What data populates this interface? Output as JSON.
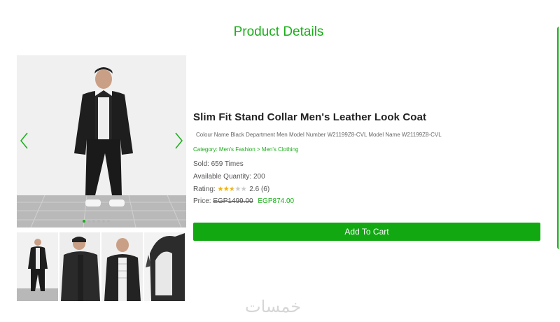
{
  "page": {
    "title": "Product Details"
  },
  "product": {
    "name": "Slim Fit Stand Collar Men's Leather Look Coat",
    "description": "Colour Name Black Department Men Model Number W21199Z8-CVL Model Name W21199Z8-CVL",
    "category_label": "Category:",
    "category_path": "Men's Fashion > Men's Clothing",
    "sold": "Sold: 659 Times",
    "quantity": "Available Quantity: 200",
    "rating_label": "Rating:",
    "rating_value": "2.6",
    "rating_count": "(6)",
    "rating_stars": 2.6,
    "price_label": "Price:",
    "old_price": "EGP1499.00",
    "new_price": "EGP874.00"
  },
  "actions": {
    "add_to_cart": "Add To Cart"
  },
  "slider": {
    "prev_icon": "chevron-left-icon",
    "next_icon": "chevron-right-icon",
    "dot_count": 6,
    "active_dot": 1
  },
  "thumbnails": [
    "front-full-view",
    "side-jacket-view",
    "front-upper-view",
    "jacket-detail-view"
  ],
  "watermark": "خمسات",
  "colors": {
    "accent": "#1aad19",
    "button": "#11a811",
    "star": "#f5b301",
    "star_empty": "#cccccc"
  }
}
